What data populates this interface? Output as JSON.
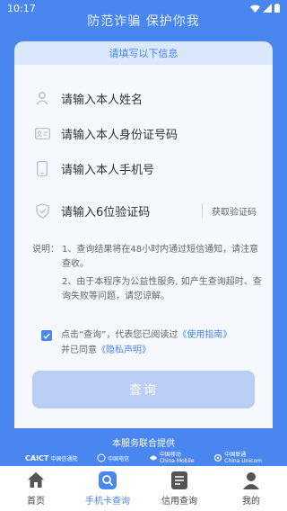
{
  "status_bar": {
    "time": "10:17"
  },
  "hero": {
    "title": "防范诈骗 保护你我"
  },
  "card": {
    "header": "请填写以下信息"
  },
  "form": {
    "name_placeholder": "请输入本人姓名",
    "id_placeholder": "请输入本人身份证号码",
    "phone_placeholder": "请输入本人手机号",
    "code_placeholder": "请输入6位验证码",
    "get_code_label": "获取验证码"
  },
  "notes": {
    "prefix": "说明：",
    "item1": "1、查询结果将在48小时内通过短信通知，请注意查收。",
    "item2": "2、由于本程序为公益性服务, 如产生查询超时、查询失败等问题，请您谅解。"
  },
  "agreement": {
    "text1": "点击“查询”，代表您已阅读过",
    "link1": "《使用指南》",
    "text2": "并已同意",
    "link2": "《隐私声明》"
  },
  "query_button": "查询",
  "providers": {
    "title": "本服务联合提供",
    "logo1": "CAICT",
    "logo1_sub": "中国信通院",
    "logo2": "中国电信",
    "logo3": "中国移动",
    "logo3_sub": "China Mobile",
    "logo4": "中国联通",
    "logo4_sub": "China Unicom"
  },
  "tabs": [
    {
      "label": "首页",
      "icon": "home-icon"
    },
    {
      "label": "手机卡查询",
      "icon": "search-icon"
    },
    {
      "label": "信用查询",
      "icon": "document-icon"
    },
    {
      "label": "我的",
      "icon": "person-icon"
    }
  ],
  "colors": {
    "primary": "#4a86f0",
    "button_disabled": "#b9cdf5",
    "card_bg": "#f5f8fd"
  }
}
